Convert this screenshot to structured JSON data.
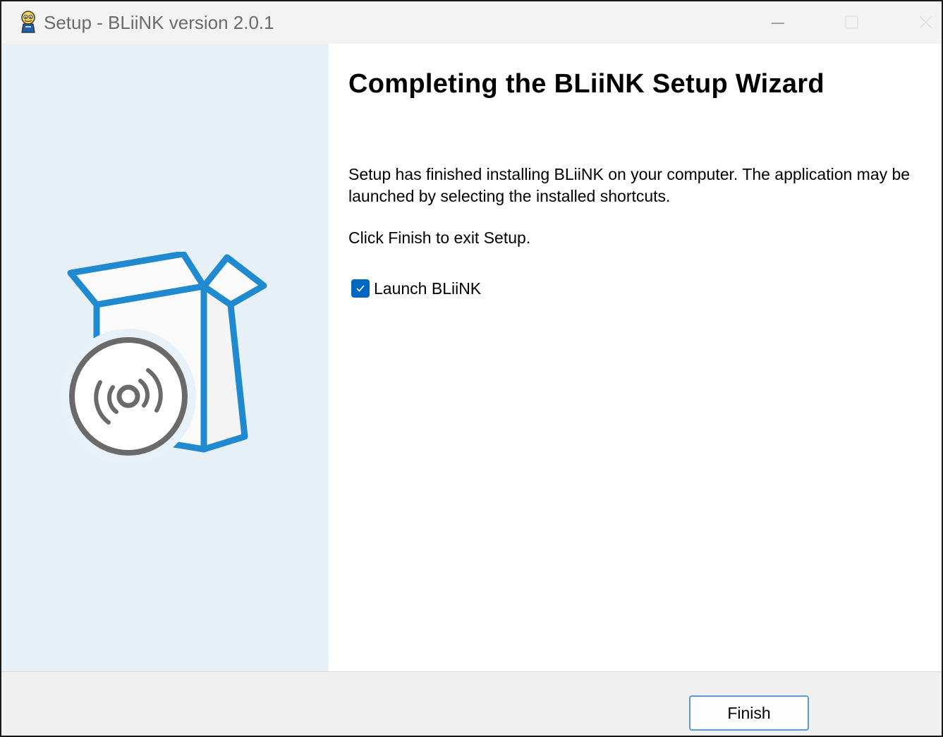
{
  "window": {
    "title": "Setup - BLiiNK version 2.0.1",
    "app_icon": "bliink-mascot-icon",
    "controls": [
      "minimize-icon",
      "maximize-icon",
      "close-icon"
    ]
  },
  "sidebar": {
    "image": "software-box-disc-illustration",
    "colors": {
      "background": "#e8f0f7",
      "box": "#1f8ad0",
      "disc": "#6a6a6a"
    }
  },
  "main": {
    "heading": "Completing the BLiiNK Setup Wizard",
    "paragraph_1": "Setup has finished installing BLiiNK on your computer. The application may be launched by selecting the installed shortcuts.",
    "paragraph_2": "Click Finish to exit Setup.",
    "launch_checkbox": {
      "label": "Launch BLiiNK",
      "checked": true,
      "icon": "checkmark-icon"
    }
  },
  "footer": {
    "finish_label": "Finish"
  },
  "colors": {
    "accent": "#0067c0",
    "button_border": "#5b9bd5",
    "titlebar": "#f3f3f3",
    "footer": "#f0f0f0"
  }
}
